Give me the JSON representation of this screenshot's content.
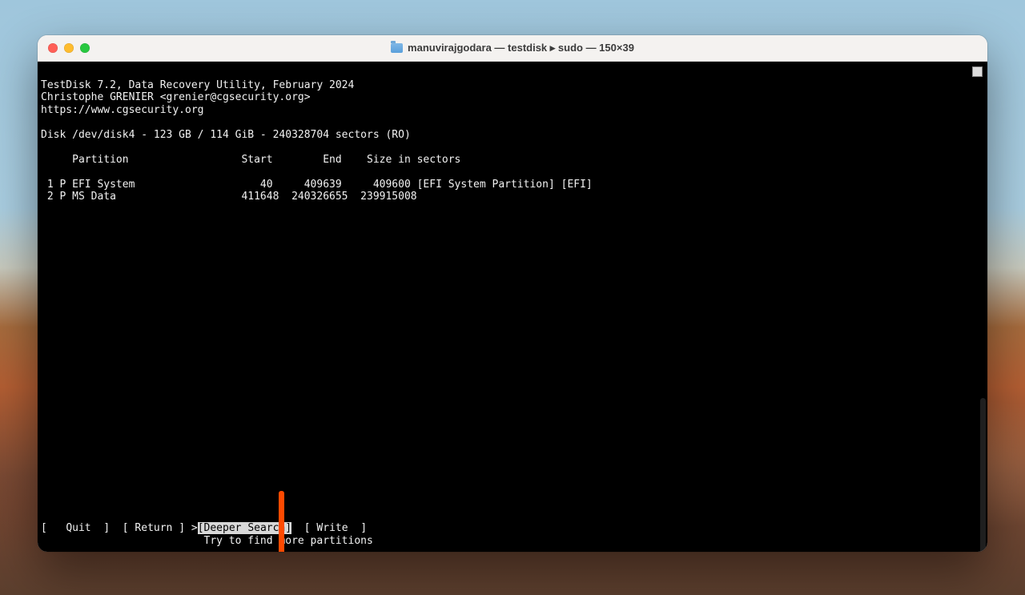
{
  "window": {
    "title": "manuvirajgodara — testdisk ▸ sudo — 150×39"
  },
  "header": {
    "line1": "TestDisk 7.2, Data Recovery Utility, February 2024",
    "line2": "Christophe GRENIER <grenier@cgsecurity.org>",
    "line3": "https://www.cgsecurity.org"
  },
  "disk_line": "Disk /dev/disk4 - 123 GB / 114 GiB - 240328704 sectors (RO)",
  "table_header": "     Partition                  Start        End    Size in sectors",
  "partitions": [
    " 1 P EFI System                    40     409639     409600 [EFI System Partition] [EFI]",
    " 2 P MS Data                    411648  240326655  239915008"
  ],
  "menu": {
    "prefix1": "[   ",
    "quit": "Quit",
    "sep1": "  ]  [ ",
    "ret": "Return",
    "sep2": " ] ",
    "caret": ">",
    "deeper": "[Deeper Search]",
    "sep3": "  [ ",
    "write": "Write",
    "suffix": "  ]"
  },
  "hint": "                          Try to find more partitions",
  "annotation": {
    "arrow_color": "#ff4a00",
    "points_to": "deeper-search-menu-item"
  }
}
